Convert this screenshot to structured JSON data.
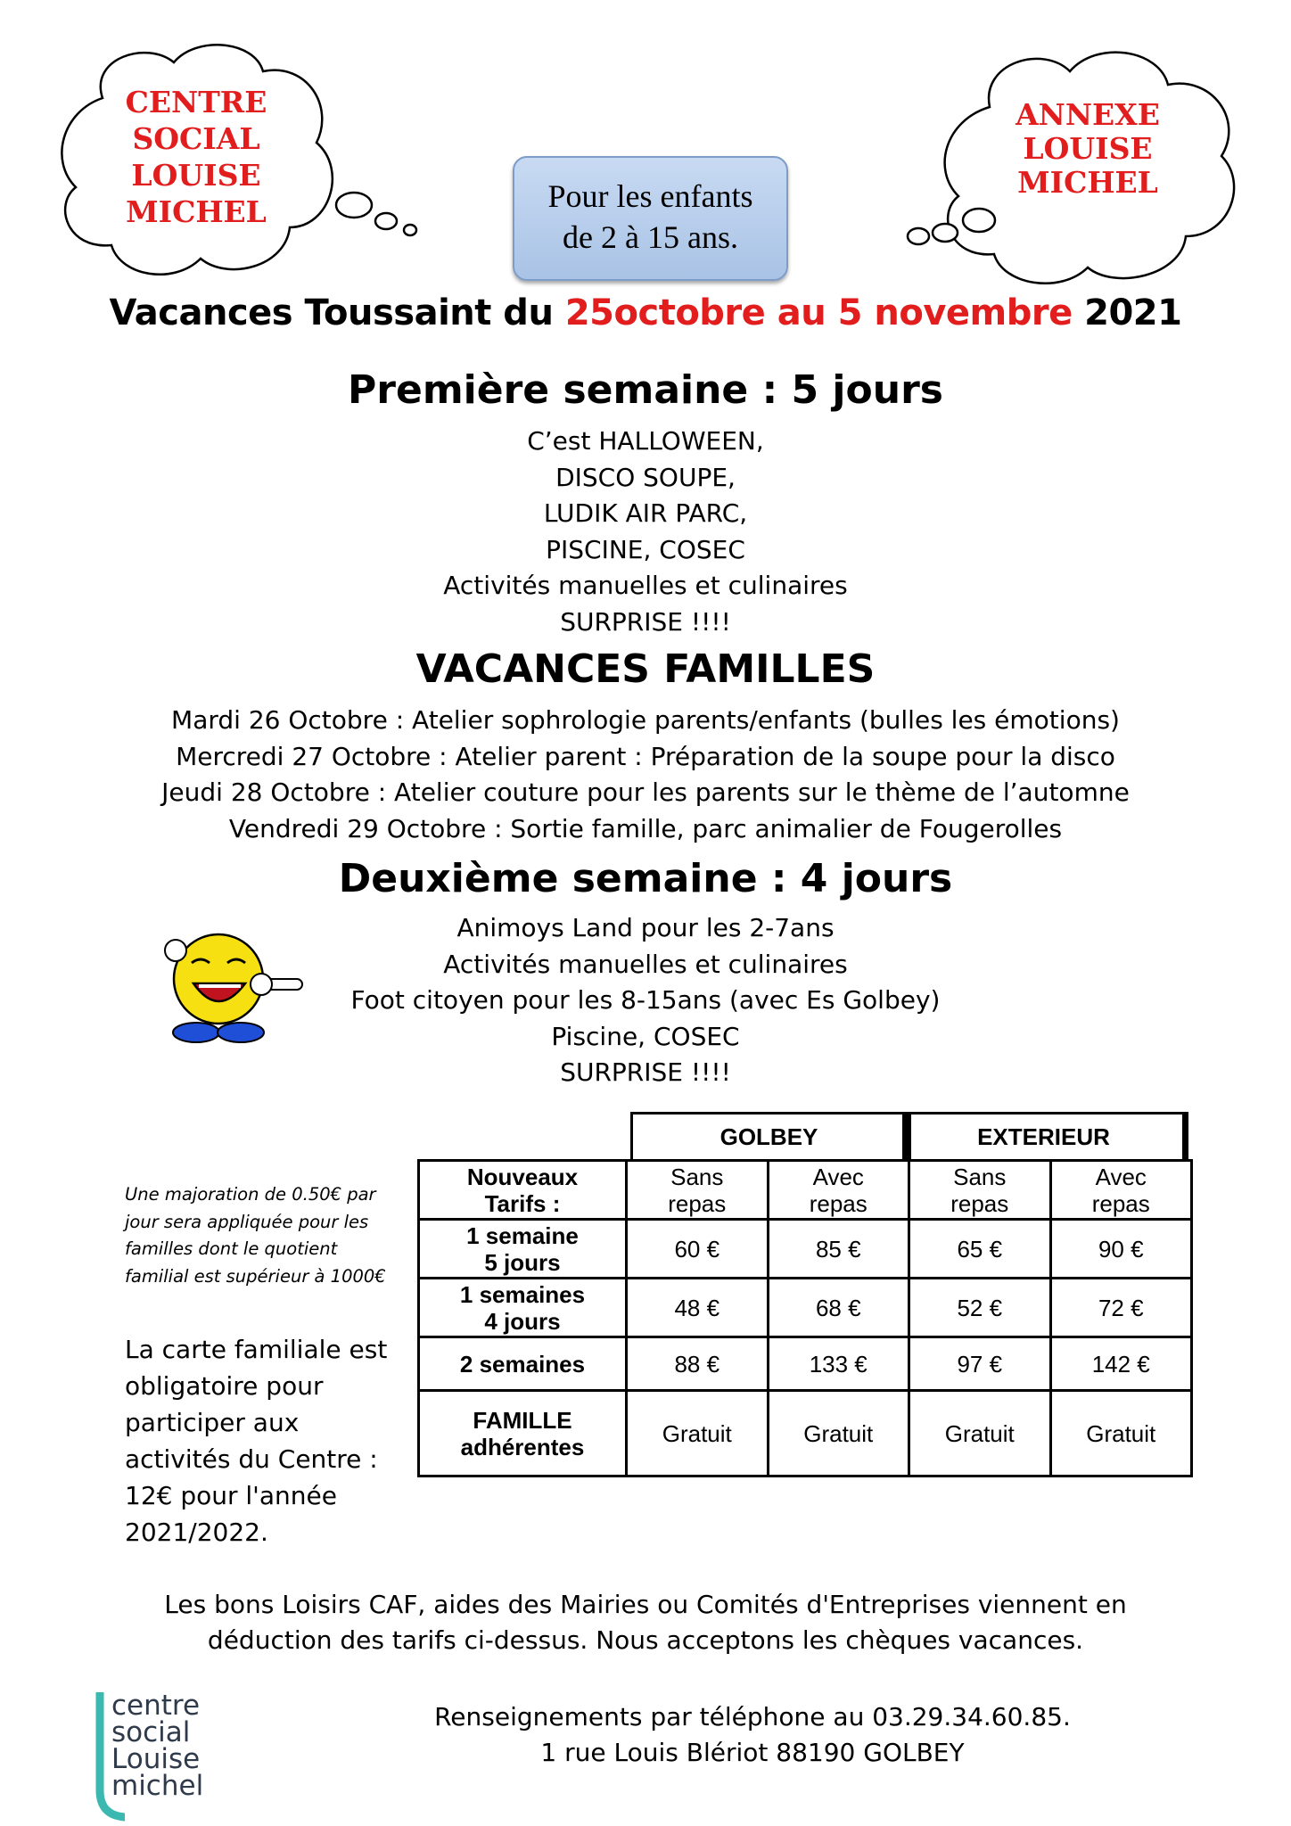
{
  "left_cloud": [
    "CENTRE",
    "SOCIAL",
    "LOUISE",
    "MICHEL"
  ],
  "right_cloud": [
    "ANNEXE",
    "LOUISE",
    "MICHEL"
  ],
  "age_box": [
    "Pour les enfants",
    "de 2 à 15 ans."
  ],
  "main_title": {
    "part1": "Vacances Toussaint du ",
    "part2": "25octobre au 5 novembre",
    "part3": " 2021"
  },
  "week1": {
    "title": "Première semaine : 5 jours",
    "items": [
      "C’est HALLOWEEN,",
      "DISCO SOUPE,",
      "LUDIK AIR PARC,",
      "PISCINE, COSEC",
      "Activités manuelles et culinaires",
      "SURPRISE !!!!"
    ]
  },
  "families": {
    "title": "VACANCES FAMILLES",
    "items": [
      "Mardi 26 Octobre :  Atelier sophrologie parents/enfants (bulles les émotions)",
      "Mercredi 27 Octobre : Atelier parent : Préparation de la soupe pour la disco",
      "Jeudi 28 Octobre : Atelier couture pour les parents sur le thème de l’automne",
      "Vendredi 29 Octobre : Sortie famille, parc animalier de Fougerolles"
    ]
  },
  "week2": {
    "title": "Deuxième semaine : 4 jours",
    "items": [
      "Animoys Land pour les 2-7ans",
      "Activités manuelles et culinaires",
      "Foot citoyen pour les 8-15ans (avec Es Golbey)",
      "Piscine, COSEC",
      "SURPRISE !!!!"
    ]
  },
  "table": {
    "group_headers": [
      "GOLBEY",
      "EXTERIEUR"
    ],
    "corner": [
      "Nouveaux",
      "Tarifs :"
    ],
    "col_headers": [
      [
        "Sans",
        "repas"
      ],
      [
        "Avec",
        "repas"
      ],
      [
        "Sans",
        "repas"
      ],
      [
        "Avec",
        "repas"
      ]
    ],
    "rows": [
      {
        "label": [
          "1 semaine",
          "5 jours"
        ],
        "values": [
          "60 €",
          "85 €",
          "65 €",
          "90 €"
        ]
      },
      {
        "label": [
          "1 semaines",
          "4 jours"
        ],
        "values": [
          "48 €",
          "68 €",
          "52 €",
          "72 €"
        ]
      },
      {
        "label": [
          "2 semaines",
          ""
        ],
        "values": [
          "88 €",
          "133 €",
          "97 €",
          "142 €"
        ]
      },
      {
        "label": [
          "FAMILLE",
          "adhérentes"
        ],
        "values": [
          "Gratuit",
          "Gratuit",
          "Gratuit",
          "Gratuit"
        ]
      }
    ]
  },
  "note": [
    "Une majoration de 0.50€ par",
    "jour sera appliquée pour les",
    "familles dont le quotient",
    "familial est supérieur à 1000€"
  ],
  "carte": [
    "La carte familiale est",
    "obligatoire pour",
    "participer aux",
    "activités du Centre :",
    "12€ pour l'année",
    "2021/2022."
  ],
  "caf": [
    "Les bons Loisirs CAF, aides des Mairies ou Comités d'Entreprises viennent en",
    "déduction des tarifs ci-dessus. Nous acceptons les chèques vacances."
  ],
  "contact": [
    "Renseignements par téléphone au 03.29.34.60.85.",
    "1 rue Louis Blériot  88190 GOLBEY"
  ],
  "logo": [
    "centre",
    "social",
    "Louise",
    "michel"
  ],
  "colors": {
    "accent_red": "#e11d1d",
    "age_box_blue": "#b9cfee",
    "logo_teal": "#3bb8b0"
  }
}
